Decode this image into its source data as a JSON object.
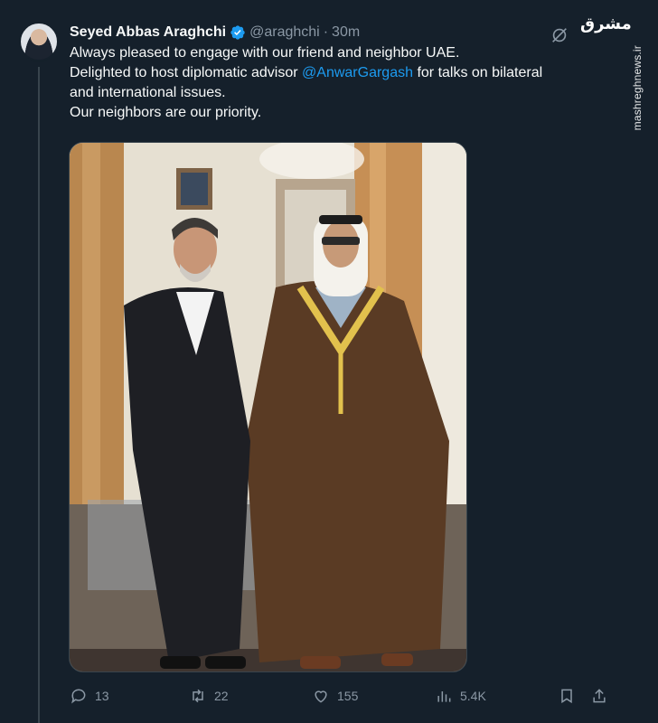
{
  "tweet": {
    "author_name": "Seyed Abbas Araghchi",
    "handle": "@araghchi",
    "separator": "·",
    "time": "30m",
    "text_lines": [
      "Always pleased to engage with our friend and neighbor UAE.",
      "Delighted to host diplomatic advisor ",
      "@AnwarGargash",
      " for talks on bilateral",
      "and international issues.",
      "Our neighbors are our priority."
    ],
    "media_alt": "Two men walking side by side in an ornate hall"
  },
  "actions": {
    "reply_count": "13",
    "retweet_count": "22",
    "like_count": "155",
    "views_count": "5.4K"
  },
  "watermark": {
    "logo_text": "مشرق",
    "url": "mashreghnews.ir"
  },
  "colors": {
    "background": "#15202b",
    "text": "#f7f9f9",
    "muted": "#8b98a5",
    "link": "#1d9bf0",
    "verified": "#1d9bf0"
  },
  "icons": [
    "verified-badge-icon",
    "grok-icon",
    "reply-icon",
    "retweet-icon",
    "like-icon",
    "views-icon",
    "bookmark-icon",
    "share-icon"
  ]
}
